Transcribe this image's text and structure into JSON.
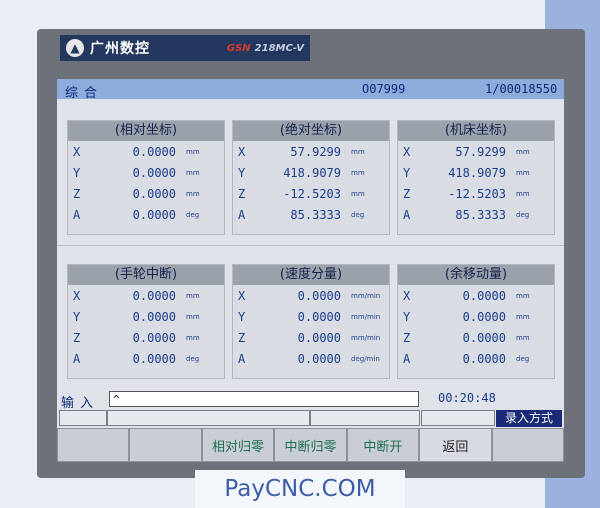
{
  "brand": {
    "logo_glyph": "▲",
    "name": "广州数控",
    "maker_tag": "GSN",
    "model": "218MC-V"
  },
  "title_bar": {
    "mode": "综合",
    "program": "O07999",
    "sequence": "1/00018550"
  },
  "panels": [
    {
      "title": "(相对坐标)",
      "rows": [
        {
          "axis": "X",
          "value": "0.0000",
          "unit": "mm"
        },
        {
          "axis": "Y",
          "value": "0.0000",
          "unit": "mm"
        },
        {
          "axis": "Z",
          "value": "0.0000",
          "unit": "mm"
        },
        {
          "axis": "A",
          "value": "0.0000",
          "unit": "deg"
        }
      ]
    },
    {
      "title": "(绝对坐标)",
      "rows": [
        {
          "axis": "X",
          "value": "57.9299",
          "unit": "mm"
        },
        {
          "axis": "Y",
          "value": "418.9079",
          "unit": "mm"
        },
        {
          "axis": "Z",
          "value": "-12.5203",
          "unit": "mm"
        },
        {
          "axis": "A",
          "value": "85.3333",
          "unit": "deg"
        }
      ]
    },
    {
      "title": "(机床坐标)",
      "rows": [
        {
          "axis": "X",
          "value": "57.9299",
          "unit": "mm"
        },
        {
          "axis": "Y",
          "value": "418.9079",
          "unit": "mm"
        },
        {
          "axis": "Z",
          "value": "-12.5203",
          "unit": "mm"
        },
        {
          "axis": "A",
          "value": "85.3333",
          "unit": "deg"
        }
      ]
    },
    {
      "title": "(手轮中断)",
      "rows": [
        {
          "axis": "X",
          "value": "0.0000",
          "unit": "mm"
        },
        {
          "axis": "Y",
          "value": "0.0000",
          "unit": "mm"
        },
        {
          "axis": "Z",
          "value": "0.0000",
          "unit": "mm"
        },
        {
          "axis": "A",
          "value": "0.0000",
          "unit": "deg"
        }
      ]
    },
    {
      "title": "(速度分量)",
      "rows": [
        {
          "axis": "X",
          "value": "0.0000",
          "unit": "mm/min"
        },
        {
          "axis": "Y",
          "value": "0.0000",
          "unit": "mm/min"
        },
        {
          "axis": "Z",
          "value": "0.0000",
          "unit": "mm/min"
        },
        {
          "axis": "A",
          "value": "0.0000",
          "unit": "deg/min"
        }
      ]
    },
    {
      "title": "(余移动量)",
      "rows": [
        {
          "axis": "X",
          "value": "0.0000",
          "unit": "mm"
        },
        {
          "axis": "Y",
          "value": "0.0000",
          "unit": "mm"
        },
        {
          "axis": "Z",
          "value": "0.0000",
          "unit": "mm"
        },
        {
          "axis": "A",
          "value": "0.0000",
          "unit": "deg"
        }
      ]
    }
  ],
  "input": {
    "label": "输入",
    "value": "^"
  },
  "clock": "00:20:48",
  "mode_badge": "录入方式",
  "softkeys": [
    "",
    "",
    "相对归零",
    "中断归零",
    "中断开",
    "返回",
    ""
  ],
  "watermark": "PayCNC.COM"
}
